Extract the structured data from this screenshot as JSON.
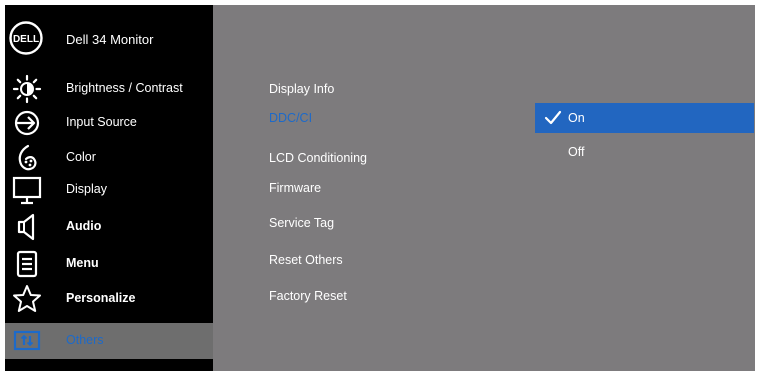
{
  "header": {
    "logo": "DELL",
    "title": "Dell 34 Monitor"
  },
  "sidebar": {
    "items": [
      {
        "label": "Brightness / Contrast",
        "icon": "brightness-icon"
      },
      {
        "label": "Input Source",
        "icon": "input-source-icon"
      },
      {
        "label": "Color",
        "icon": "color-icon"
      },
      {
        "label": "Display",
        "icon": "display-icon"
      },
      {
        "label": "Audio",
        "icon": "audio-icon"
      },
      {
        "label": "Menu",
        "icon": "menu-icon"
      },
      {
        "label": "Personalize",
        "icon": "personalize-icon"
      },
      {
        "label": "Others",
        "icon": "others-icon"
      }
    ],
    "selected": "Others"
  },
  "submenu": {
    "items": [
      {
        "label": "Display Info"
      },
      {
        "label": "DDC/CI"
      },
      {
        "label": "LCD Conditioning"
      },
      {
        "label": "Firmware"
      },
      {
        "label": "Service Tag"
      },
      {
        "label": "Reset Others"
      },
      {
        "label": "Factory Reset"
      }
    ],
    "selected": "DDC/CI"
  },
  "options": {
    "on_label": "On",
    "off_label": "Off",
    "selected": "On"
  },
  "colors": {
    "background": "#7d7b7d",
    "sidebar": "#000000",
    "accent": "#2266c0",
    "highlight_text": "#1d6ac9"
  }
}
